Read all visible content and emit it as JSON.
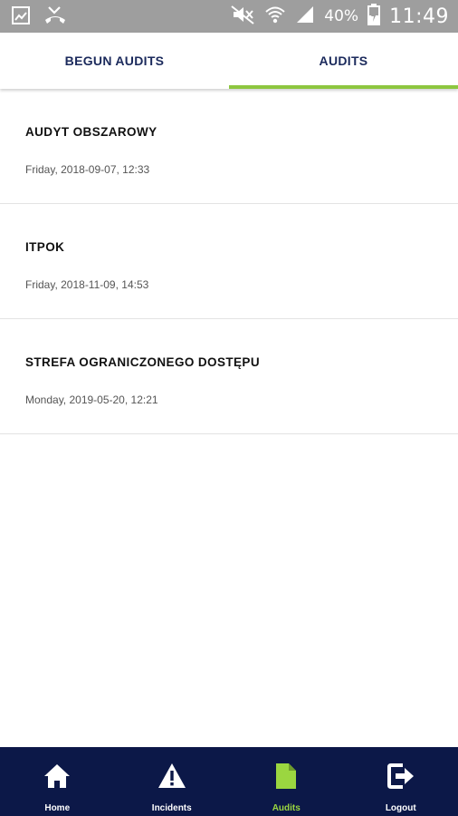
{
  "status_bar": {
    "battery": "40%",
    "time": "11:49"
  },
  "tabs": [
    {
      "label": "BEGUN AUDITS",
      "active": false
    },
    {
      "label": "AUDITS",
      "active": true
    }
  ],
  "audits": [
    {
      "title": "AUDYT OBSZAROWY",
      "date": "Friday, 2018-09-07, 12:33"
    },
    {
      "title": "ITPOK",
      "date": "Friday, 2018-11-09, 14:53"
    },
    {
      "title": "STREFA OGRANICZONEGO DOSTĘPU",
      "date": "Monday, 2019-05-20, 12:21"
    }
  ],
  "bottom_nav": [
    {
      "label": "Home",
      "icon": "home-icon",
      "active": false
    },
    {
      "label": "Incidents",
      "icon": "warning-icon",
      "active": false
    },
    {
      "label": "Audits",
      "icon": "document-icon",
      "active": true
    },
    {
      "label": "Logout",
      "icon": "logout-icon",
      "active": false
    }
  ],
  "colors": {
    "accent": "#8dc63f",
    "nav_background": "#0c1848",
    "tab_text": "#1b2a5c",
    "status_bar": "#9e9e9e"
  }
}
